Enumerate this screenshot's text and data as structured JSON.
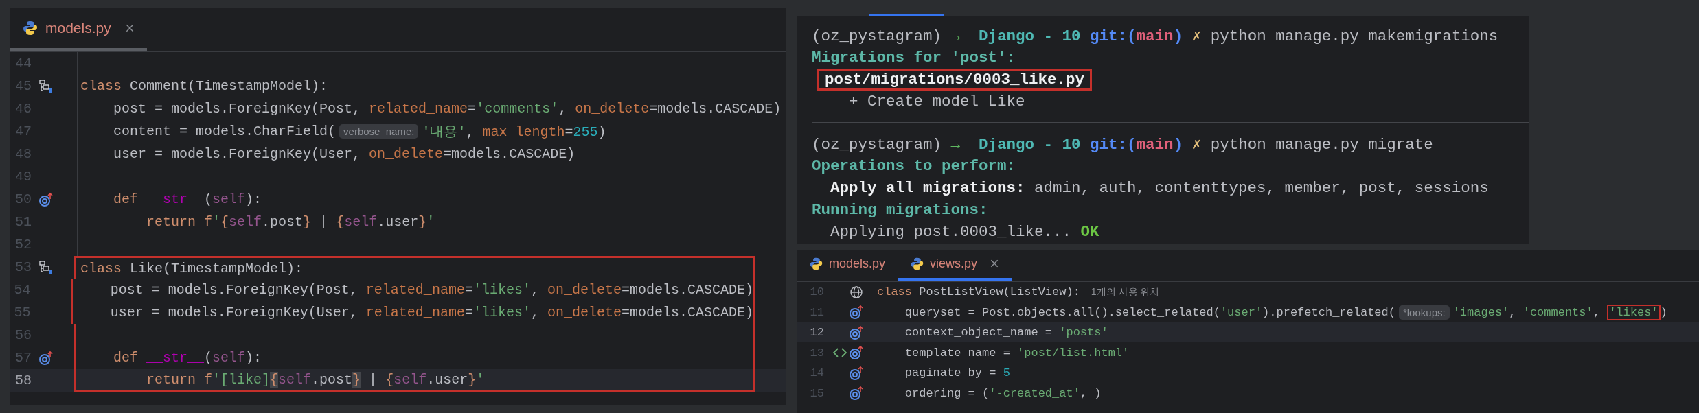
{
  "left_editor": {
    "focused": false,
    "tabs": [
      {
        "label": "models.py",
        "selected": true,
        "closable": true
      }
    ],
    "lines": [
      {
        "number": "44",
        "current": false,
        "highlighted": false
      },
      {
        "number": "45",
        "current": false,
        "highlighted": false,
        "gutter": [
          {
            "kind": "model"
          }
        ],
        "tokens": [
          {
            "kind": "kw",
            "text": "class "
          },
          {
            "kind": "pl",
            "text": "Comment(TimestampModel):"
          }
        ]
      },
      {
        "number": "46",
        "current": false,
        "highlighted": false,
        "tokens": [
          {
            "kind": "pl",
            "text": "    post = models.ForeignKey(Post, "
          },
          {
            "kind": "arg",
            "text": "related_name"
          },
          {
            "kind": "pl",
            "text": "="
          },
          {
            "kind": "str",
            "text": "'comments'"
          },
          {
            "kind": "pl",
            "text": ", "
          },
          {
            "kind": "arg",
            "text": "on_delete"
          },
          {
            "kind": "pl",
            "text": "=models.CASCADE)"
          }
        ]
      },
      {
        "number": "47",
        "current": false,
        "highlighted": false,
        "tokens": [
          {
            "kind": "pl",
            "text": "    content = models.CharField("
          },
          {
            "kind": "hint",
            "text": "verbose_name:"
          },
          {
            "kind": "str",
            "text": "'내용'"
          },
          {
            "kind": "pl",
            "text": ", "
          },
          {
            "kind": "arg",
            "text": "max_length"
          },
          {
            "kind": "pl",
            "text": "="
          },
          {
            "kind": "num",
            "text": "255"
          },
          {
            "kind": "pl",
            "text": ")"
          }
        ]
      },
      {
        "number": "48",
        "current": false,
        "highlighted": false,
        "tokens": [
          {
            "kind": "pl",
            "text": "    user = models.ForeignKey(User, "
          },
          {
            "kind": "arg",
            "text": "on_delete"
          },
          {
            "kind": "pl",
            "text": "=models.CASCADE)"
          }
        ]
      },
      {
        "number": "49",
        "current": false,
        "highlighted": false
      },
      {
        "number": "50",
        "current": false,
        "highlighted": false,
        "gutter": [
          {
            "kind": "override"
          }
        ],
        "tokens": [
          {
            "kind": "kw",
            "text": "    def "
          },
          {
            "kind": "dun",
            "text": "__str__"
          },
          {
            "kind": "pl",
            "text": "("
          },
          {
            "kind": "self",
            "text": "self"
          },
          {
            "kind": "pl",
            "text": "):"
          }
        ]
      },
      {
        "number": "51",
        "current": false,
        "highlighted": false,
        "tokens": [
          {
            "kind": "kw",
            "text": "        return f"
          },
          {
            "kind": "str",
            "text": "'"
          },
          {
            "kind": "brace",
            "text": "{"
          },
          {
            "kind": "self",
            "text": "self"
          },
          {
            "kind": "pl",
            "text": ".post"
          },
          {
            "kind": "brace",
            "text": "}"
          },
          {
            "kind": "pl",
            "text": " | "
          },
          {
            "kind": "brace",
            "text": "{"
          },
          {
            "kind": "self",
            "text": "self"
          },
          {
            "kind": "pl",
            "text": ".user"
          },
          {
            "kind": "brace",
            "text": "}"
          },
          {
            "kind": "str",
            "text": "'"
          }
        ]
      },
      {
        "number": "52",
        "current": false,
        "highlighted": false
      },
      {
        "number": "53",
        "current": false,
        "highlighted": true,
        "gutter": [
          {
            "kind": "model"
          }
        ],
        "tokens": [
          {
            "kind": "kw",
            "text": "class "
          },
          {
            "kind": "pl",
            "text": "Like(TimestampModel):"
          }
        ]
      },
      {
        "number": "54",
        "current": false,
        "highlighted": true,
        "tokens": [
          {
            "kind": "pl",
            "text": "    post = models.ForeignKey(Post, "
          },
          {
            "kind": "arg",
            "text": "related_name"
          },
          {
            "kind": "pl",
            "text": "="
          },
          {
            "kind": "str",
            "text": "'likes'"
          },
          {
            "kind": "pl",
            "text": ", "
          },
          {
            "kind": "arg",
            "text": "on_delete"
          },
          {
            "kind": "pl",
            "text": "=models.CASCADE)"
          }
        ]
      },
      {
        "number": "55",
        "current": false,
        "highlighted": true,
        "tokens": [
          {
            "kind": "pl",
            "text": "    user = models.ForeignKey(User, "
          },
          {
            "kind": "arg",
            "text": "related_name"
          },
          {
            "kind": "pl",
            "text": "="
          },
          {
            "kind": "str",
            "text": "'likes'"
          },
          {
            "kind": "pl",
            "text": ", "
          },
          {
            "kind": "arg",
            "text": "on_delete"
          },
          {
            "kind": "pl",
            "text": "=models.CASCADE)"
          }
        ]
      },
      {
        "number": "56",
        "current": false,
        "highlighted": true
      },
      {
        "number": "57",
        "current": false,
        "highlighted": true,
        "gutter": [
          {
            "kind": "override"
          }
        ],
        "tokens": [
          {
            "kind": "kw",
            "text": "    def "
          },
          {
            "kind": "dun",
            "text": "__str__"
          },
          {
            "kind": "pl",
            "text": "("
          },
          {
            "kind": "self",
            "text": "self"
          },
          {
            "kind": "pl",
            "text": "):"
          }
        ]
      },
      {
        "number": "58",
        "current": true,
        "highlighted": true,
        "tokens": [
          {
            "kind": "kw",
            "text": "        return f"
          },
          {
            "kind": "str",
            "text": "'[like]"
          },
          {
            "kind": "bm",
            "text": "{"
          },
          {
            "kind": "self",
            "text": "self"
          },
          {
            "kind": "pl",
            "text": ".post"
          },
          {
            "kind": "bm",
            "text": "}"
          },
          {
            "kind": "pl",
            "text": " | "
          },
          {
            "kind": "brace",
            "text": "{"
          },
          {
            "kind": "self",
            "text": "self"
          },
          {
            "kind": "pl",
            "text": ".user"
          },
          {
            "kind": "brace",
            "text": "}"
          },
          {
            "kind": "str",
            "text": "'"
          }
        ]
      }
    ]
  },
  "terminal": {
    "blocks": [
      {
        "lines": [
          [
            {
              "kind": "paren",
              "text": "(oz_pystagram) "
            },
            {
              "kind": "arrow",
              "text": "→  "
            },
            {
              "kind": "dir",
              "text": "Django - 10 "
            },
            {
              "kind": "git",
              "text": "git:("
            },
            {
              "kind": "branch",
              "text": "main"
            },
            {
              "kind": "git",
              "text": ") "
            },
            {
              "kind": "dirty",
              "text": "✗ "
            },
            {
              "kind": "out",
              "text": "python manage.py makemigrations"
            }
          ],
          [
            {
              "kind": "heading",
              "text": "Migrations for 'post':"
            }
          ],
          [
            {
              "kind": "bold",
              "text": "post/migrations/0003_like.py",
              "boxed": true
            }
          ],
          [
            {
              "kind": "out",
              "text": "    + Create model Like"
            }
          ]
        ]
      },
      {
        "lines": [
          [
            {
              "kind": "paren",
              "text": "(oz_pystagram) "
            },
            {
              "kind": "arrow",
              "text": "→  "
            },
            {
              "kind": "dir",
              "text": "Django - 10 "
            },
            {
              "kind": "git",
              "text": "git:("
            },
            {
              "kind": "branch",
              "text": "main"
            },
            {
              "kind": "git",
              "text": ") "
            },
            {
              "kind": "dirty",
              "text": "✗ "
            },
            {
              "kind": "out",
              "text": "python manage.py migrate"
            }
          ],
          [
            {
              "kind": "heading",
              "text": "Operations to perform:"
            }
          ],
          [
            {
              "kind": "bold",
              "text": "  Apply all migrations:"
            },
            {
              "kind": "out",
              "text": " admin, auth, contenttypes, member, post, sessions"
            }
          ],
          [
            {
              "kind": "heading",
              "text": "Running migrations:"
            }
          ],
          [
            {
              "kind": "out",
              "text": "  Applying post.0003_like... "
            },
            {
              "kind": "ok",
              "text": "OK"
            }
          ]
        ]
      }
    ]
  },
  "right_editor": {
    "focused": true,
    "tabs": [
      {
        "label": "models.py",
        "selected": false,
        "closable": false
      },
      {
        "label": "views.py",
        "selected": true,
        "closable": true
      }
    ],
    "lines": [
      {
        "number": "10",
        "current": false,
        "gutter": [
          {
            "kind": "globe"
          }
        ],
        "tokens": [
          {
            "kind": "kw",
            "text": "class "
          },
          {
            "kind": "pl",
            "text": "PostListView(ListView):"
          },
          {
            "kind": "usage",
            "text": "1개의 사용 위치"
          }
        ]
      },
      {
        "number": "11",
        "current": false,
        "gutter": [
          {
            "kind": "override"
          }
        ],
        "tokens": [
          {
            "kind": "pl",
            "text": "    queryset = Post.objects.all().select_related("
          },
          {
            "kind": "str",
            "text": "'user'"
          },
          {
            "kind": "pl",
            "text": ").prefetch_related("
          },
          {
            "kind": "hint",
            "text": "*lookups:"
          },
          {
            "kind": "str",
            "text": "'images'"
          },
          {
            "kind": "pl",
            "text": ", "
          },
          {
            "kind": "str",
            "text": "'comments'"
          },
          {
            "kind": "pl",
            "text": ", "
          },
          {
            "kind": "str",
            "text": "'likes'",
            "boxed": true
          },
          {
            "kind": "pl",
            "text": ")"
          }
        ]
      },
      {
        "number": "12",
        "current": true,
        "gutter": [
          {
            "kind": "override"
          }
        ],
        "tokens": [
          {
            "kind": "pl",
            "text": "    context_object_name = "
          },
          {
            "kind": "str",
            "text": "'posts'"
          }
        ]
      },
      {
        "number": "13",
        "current": false,
        "gutter": [
          {
            "kind": "tag"
          },
          {
            "kind": "override"
          }
        ],
        "tokens": [
          {
            "kind": "pl",
            "text": "    template_name = "
          },
          {
            "kind": "str",
            "text": "'post/list.html'"
          }
        ]
      },
      {
        "number": "14",
        "current": false,
        "gutter": [
          {
            "kind": "override"
          }
        ],
        "tokens": [
          {
            "kind": "pl",
            "text": "    paginate_by = "
          },
          {
            "kind": "num",
            "text": "5"
          }
        ]
      },
      {
        "number": "15",
        "current": false,
        "gutter": [
          {
            "kind": "override"
          }
        ],
        "tokens": [
          {
            "kind": "pl",
            "text": "    ordering = ("
          },
          {
            "kind": "str",
            "text": "'-created_at'"
          },
          {
            "kind": "pl",
            "text": ", )"
          }
        ]
      }
    ]
  }
}
